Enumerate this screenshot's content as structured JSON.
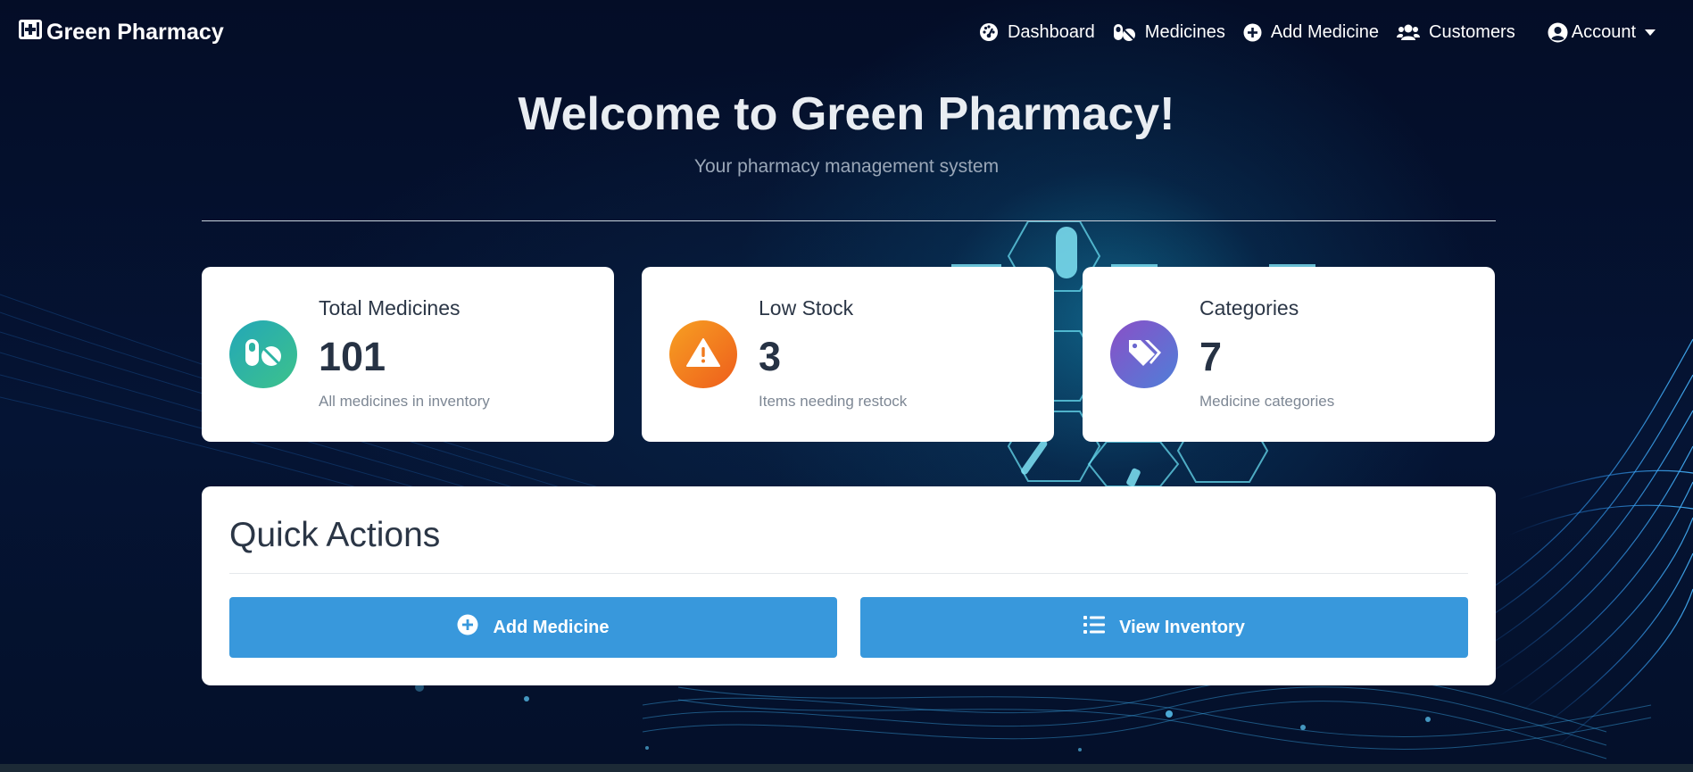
{
  "app": {
    "brand": "Green Pharmacy",
    "accent_color": "#3898dc"
  },
  "nav": {
    "items": [
      {
        "label": "Dashboard",
        "icon": "gauge-icon"
      },
      {
        "label": "Medicines",
        "icon": "pills-icon"
      },
      {
        "label": "Add Medicine",
        "icon": "plus-circle-icon"
      },
      {
        "label": "Customers",
        "icon": "users-icon"
      }
    ],
    "account": {
      "label": "Account",
      "icon": "user-circle-icon"
    }
  },
  "hero": {
    "title": "Welcome to Green Pharmacy!",
    "subtitle": "Your pharmacy management system"
  },
  "stats": [
    {
      "title": "Total Medicines",
      "value": "101",
      "description": "All medicines in inventory",
      "icon": "pills-icon",
      "color": "#2fb39a"
    },
    {
      "title": "Low Stock",
      "value": "3",
      "description": "Items needing restock",
      "icon": "warning-icon",
      "color": "#f3701f"
    },
    {
      "title": "Categories",
      "value": "7",
      "description": "Medicine categories",
      "icon": "tags-icon",
      "color": "#6d63c9"
    }
  ],
  "quick_actions": {
    "title": "Quick Actions",
    "buttons": [
      {
        "label": "Add Medicine",
        "icon": "plus-circle-icon"
      },
      {
        "label": "View Inventory",
        "icon": "list-icon"
      }
    ]
  }
}
